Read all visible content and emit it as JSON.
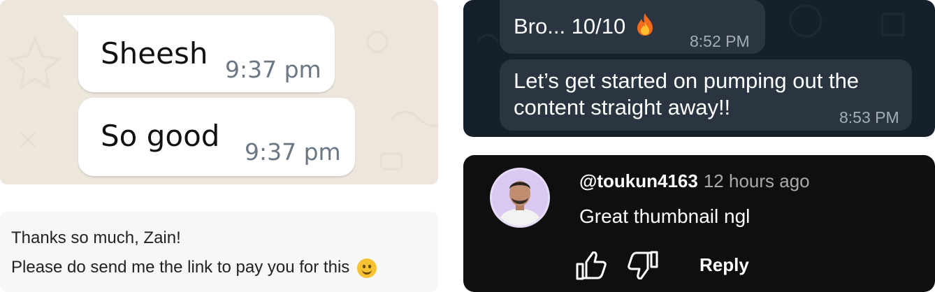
{
  "light_chat": {
    "messages": [
      {
        "text": "Sheesh",
        "time": "9:37 pm"
      },
      {
        "text": "So good",
        "time": "9:37 pm"
      }
    ]
  },
  "email_note": {
    "line1": "Thanks so much, Zain!",
    "line2": "Please do send me the link to pay you for this",
    "emoji": "smiling-face-emoji"
  },
  "dark_chat": {
    "messages": [
      {
        "text": "Bro... 10/10",
        "emoji": "fire-emoji",
        "time": "8:52 PM"
      },
      {
        "text_line1": "Let’s get started on pumping out the",
        "text_line2": "content straight away!!",
        "time": "8:53 PM"
      }
    ]
  },
  "comment": {
    "handle": "@toukun4163",
    "time_ago": "12 hours ago",
    "text": "Great thumbnail ngl",
    "reply_label": "Reply",
    "like_icon": "thumbs-up-icon",
    "dislike_icon": "thumbs-down-icon"
  }
}
